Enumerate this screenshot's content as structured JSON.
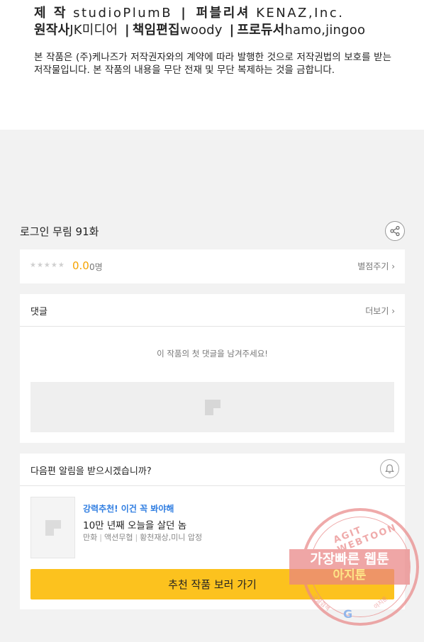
{
  "credits": {
    "production_label": "제 작",
    "production_value": "studioPlumB",
    "publisher_label": "퍼블리셔",
    "publisher_value": "KENAZ,Inc.",
    "original_label": "원작사",
    "original_value": "JK미디어",
    "editor_label": "책임편집",
    "editor_value": "woody",
    "producer_label": "프로듀서",
    "producer_value": "hamo,jingoo",
    "separator": "|",
    "copyright_text": "본 작품은 (주)케나즈가 저작권자와의 계약에 따라 발행한 것으로 저작권법의 보호를 받는 저작물입니다. 본 작품의 내용을 무단 전재 및 무단 복제하는 것을 금합니다."
  },
  "episode": {
    "title": "로그인 무림 91화",
    "share_icon": "share-icon"
  },
  "rating": {
    "stars": "★★★★★",
    "score": "0.0",
    "raters": "0명",
    "rate_link": "별점주기 ›"
  },
  "comments": {
    "label": "댓글",
    "more_link": "더보기 ›",
    "empty_text": "이 작품의 첫 댓글을 남겨주세요!"
  },
  "notify": {
    "question": "다음편 알림을 받으시겠습니까?",
    "bell_icon": "bell-icon"
  },
  "recommendation": {
    "tag": "강력추천! 이건 꼭 봐야해",
    "title": "10만 년째 오늘을 살던 놈",
    "genres": [
      "만화",
      "액션무협",
      "황천재상,미니 압정"
    ],
    "button_label": "추천 작품 보러 가기"
  },
  "watermark": {
    "top_text": "AGIT WEBTOON",
    "main_text": "가장빠른 웹툰",
    "sub_text": "아지툰",
    "left_text": "구글검색",
    "right_text": "아지툰",
    "g_letter": "G"
  },
  "colors": {
    "accent_yellow": "#fcc21e",
    "score_orange": "#f5a300",
    "tag_blue": "#2f7de1",
    "watermark_red": "#ea8484"
  }
}
